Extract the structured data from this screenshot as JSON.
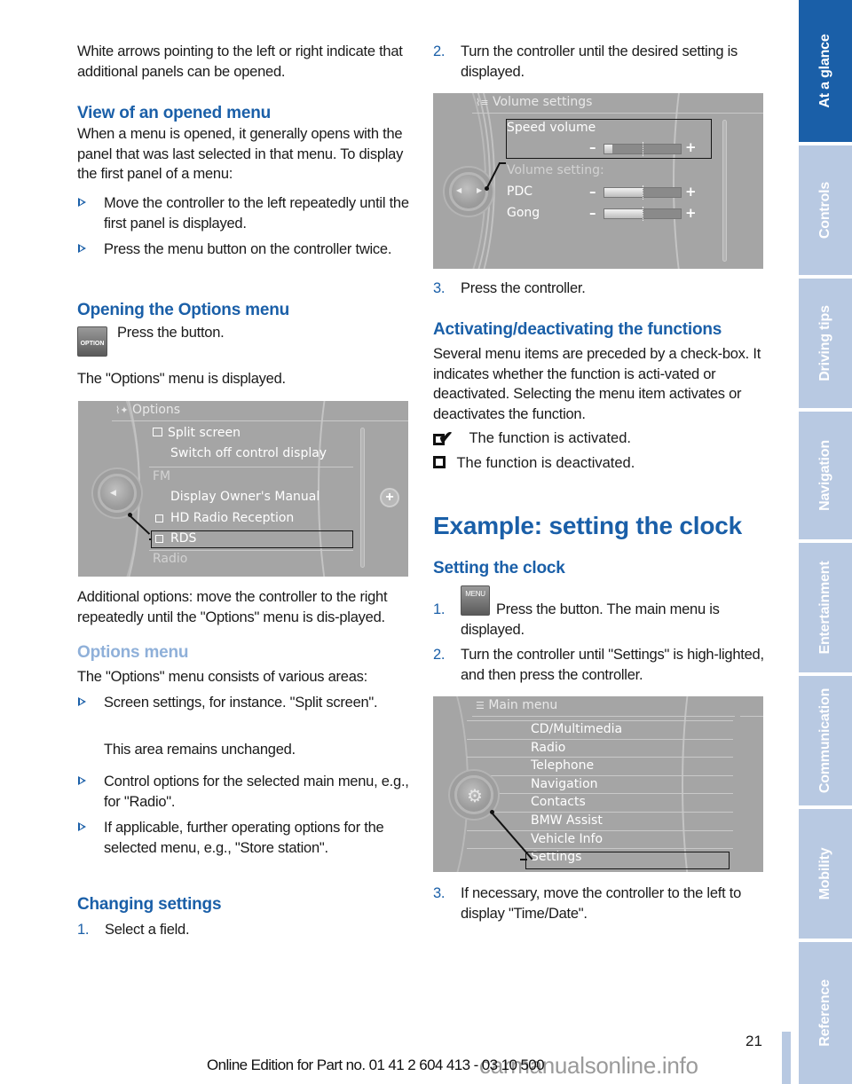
{
  "left": {
    "intro": "White arrows pointing to the left or right indicate that additional panels can be opened.",
    "view_heading": "View of an opened menu",
    "view_text": "When a menu is opened, it generally opens with the panel that was last selected in that menu. To display the first panel of a menu:",
    "view_bullets": [
      "Move the controller to the left repeatedly until the first panel is displayed.",
      "Press the menu button on the controller twice."
    ],
    "options_heading": "Opening the Options menu",
    "option_button_label": "OPTION",
    "press_button": "Press the button.",
    "options_displayed": "The \"Options\" menu is displayed.",
    "options_screen": {
      "title": "Options",
      "items": [
        "Split screen",
        "Switch off control display",
        "FM",
        "Display Owner's Manual",
        "HD Radio Reception",
        "RDS",
        "Radio"
      ]
    },
    "additional": "Additional options: move the controller to the right repeatedly until the \"Options\" menu is dis-played.",
    "options_menu_heading": "Options menu",
    "options_menu_text": "The \"Options\" menu consists of various areas:",
    "options_bullets": [
      "Screen settings, for instance. \"Split screen\".",
      "Control options for the selected main menu, e.g., for \"Radio\".",
      "If applicable, further operating options for the selected menu, e.g., \"Store station\"."
    ],
    "unchanged_note": "This area remains unchanged.",
    "changing_heading": "Changing settings",
    "changing_steps": [
      {
        "n": "1.",
        "text": "Select a field."
      }
    ]
  },
  "right": {
    "step2": {
      "n": "2.",
      "text": "Turn the controller until the desired setting is displayed."
    },
    "volume_screen": {
      "title": "Volume settings",
      "speed_volume": "Speed volume",
      "volume_setting": "Volume setting:",
      "pdc": "PDC",
      "gong": "Gong",
      "speed_volume_level": 0.1,
      "pdc_level": 0.5,
      "gong_level": 0.5,
      "minus": "–",
      "plus": "+"
    },
    "step3": {
      "n": "3.",
      "text": "Press the controller."
    },
    "activating_heading": "Activating/deactivating the functions",
    "activating_text": "Several menu items are preceded by a check-box. It indicates whether the function is acti-vated or deactivated. Selecting the menu item activates or deactivates the function.",
    "activated": "The function is activated.",
    "deactivated": "The function is deactivated.",
    "example_heading": "Example: setting the clock",
    "clock_heading": "Setting the clock",
    "menu_button_label": "MENU",
    "clock_steps": [
      {
        "n": "1.",
        "text": "Press the button. The main menu is displayed."
      },
      {
        "n": "2.",
        "text": "Turn the controller until \"Settings\" is high-lighted, and then press the controller."
      },
      {
        "n": "3.",
        "text": "If necessary, move the controller to the left to display \"Time/Date\"."
      }
    ],
    "main_screen": {
      "title": "Main menu",
      "items": [
        "CD/Multimedia",
        "Radio",
        "Telephone",
        "Navigation",
        "Contacts",
        "BMW Assist",
        "Vehicle Info",
        "Settings"
      ]
    }
  },
  "tabs": [
    "At a glance",
    "Controls",
    "Driving tips",
    "Navigation",
    "Entertainment",
    "Communication",
    "Mobility",
    "Reference"
  ],
  "active_tab": "At a glance",
  "footer": {
    "page_number": "21",
    "edition": "Online Edition for Part no. 01 41 2 604 413 - 03 10 500",
    "watermark": "carmanualsonline.info"
  },
  "colors": {
    "accent": "#1a5fa8",
    "accent_light": "#8fb0d9",
    "tab_inactive": "#b8c9e2",
    "screen_bg": "#a5a5a5"
  }
}
